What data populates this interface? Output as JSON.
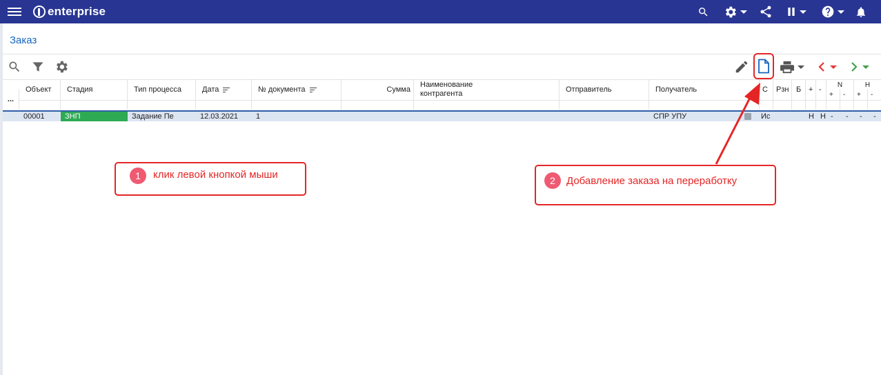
{
  "app": {
    "brand": "enterprise"
  },
  "page": {
    "title": "Заказ"
  },
  "columns": [
    "Объект",
    "Стадия",
    "Тип процесса",
    "Дата",
    "№ документа",
    "Сумма",
    "Наименование контрагента",
    "Отправитель",
    "Получатель",
    "С",
    "Рзн",
    "Б",
    "+",
    "-",
    "N",
    "H"
  ],
  "sub_columns": {
    "n_plus": "+",
    "n_minus": "-",
    "h_plus": "+",
    "h_minus": "-"
  },
  "row": {
    "object": "00001",
    "stage": "ЗНП",
    "process": "Задание Пе",
    "date": "12.03.2021",
    "doc_no": "1",
    "recipient": "СПР УПУ",
    "c": "Ис",
    "plus": "Н",
    "minus": "Н",
    "n_plus": "-",
    "n_minus": "-",
    "h_plus": "-",
    "h_minus": "-"
  },
  "row_menu": "...",
  "callouts": [
    {
      "num": "1",
      "text": "клик левой кнопкой мыши"
    },
    {
      "num": "2",
      "text": "Добавление заказа на переработку"
    }
  ],
  "colors": {
    "topbar": "#283593",
    "accent": "#1565c0",
    "stage": "#2eaa55",
    "annotation": "#e52525"
  }
}
